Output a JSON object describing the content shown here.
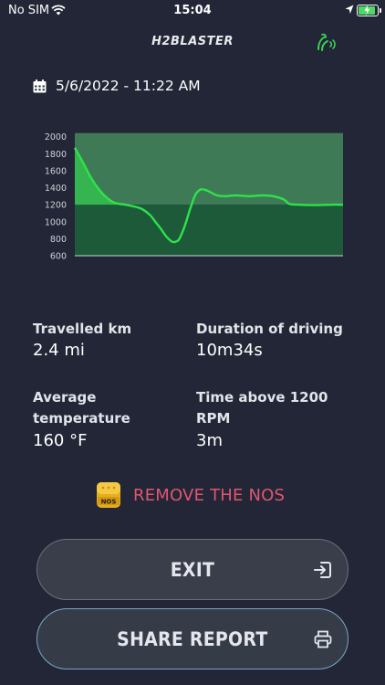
{
  "status_bar": {
    "carrier": "No SIM",
    "time": "15:04"
  },
  "header": {
    "brand": "H2BLASTER"
  },
  "report": {
    "date": "5/6/2022 - 11:22 AM"
  },
  "chart_data": {
    "type": "line",
    "y_ticks": [
      "2000",
      "1800",
      "1600",
      "1400",
      "1200",
      "1000",
      "800",
      "600"
    ],
    "ylim": [
      600,
      2050
    ],
    "threshold": 1200,
    "grid": false,
    "series": [
      {
        "x": [
          0,
          0.03,
          0.06,
          0.09,
          0.12,
          0.15,
          0.19,
          0.22,
          0.25,
          0.28,
          0.3,
          0.32,
          0.34,
          0.36,
          0.37,
          0.38,
          0.39,
          0.41,
          0.43,
          0.45,
          0.47,
          0.49,
          0.51,
          0.53,
          0.56,
          0.6,
          0.65,
          0.7,
          0.74,
          0.78,
          0.8,
          0.84,
          0.9,
          0.95,
          1.0
        ],
        "values": [
          1870,
          1700,
          1520,
          1380,
          1280,
          1220,
          1200,
          1180,
          1150,
          1080,
          1000,
          920,
          830,
          770,
          760,
          770,
          800,
          950,
          1150,
          1320,
          1380,
          1370,
          1340,
          1310,
          1300,
          1310,
          1300,
          1310,
          1300,
          1260,
          1210,
          1200,
          1195,
          1200,
          1200
        ]
      }
    ],
    "colors": {
      "line": "#2ee24a",
      "above_area": "#3f7a57",
      "below_area": "#1d5a3a",
      "fill_under_curve": "#34c04d"
    }
  },
  "stats": {
    "travelled_label": "Travelled km",
    "travelled_value": "2.4 mi",
    "duration_label": "Duration of driving",
    "duration_value": "10m34s",
    "temp_label_line1": "Average",
    "temp_label_line2": "temperature",
    "temp_value": "160 °F",
    "rpm_label_line1": "Time above 1200",
    "rpm_label_line2": "RPM",
    "rpm_value": "3m"
  },
  "warning": {
    "badge_text": "NOS",
    "text": "REMOVE THE NOS"
  },
  "buttons": {
    "exit_label": "EXIT",
    "share_label": "SHARE REPORT"
  },
  "icons": {
    "calendar": "calendar-icon",
    "exit": "sign-in-icon",
    "share": "printer-icon",
    "brand": "leaf-wave-icon"
  }
}
